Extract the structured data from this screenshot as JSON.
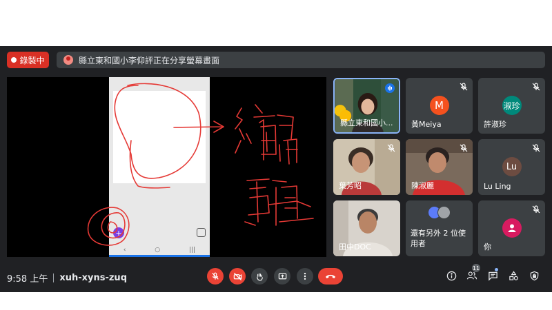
{
  "recording": {
    "label": "錄製中"
  },
  "share_banner": {
    "text": "縣立東和國小李仰評正在分享螢幕畫面"
  },
  "participants": [
    {
      "name": "縣立東和國小..."
    },
    {
      "name": "黃Meiya",
      "initial": "M"
    },
    {
      "name": "許淑珍",
      "initial": "淑珍"
    },
    {
      "name": "葉芳昭"
    },
    {
      "name": "陳淑麗"
    },
    {
      "name": "Lu Ling",
      "initial": "Lu"
    },
    {
      "name": "田中DOC"
    },
    {
      "name": "還有另外 2 位使用者"
    },
    {
      "name": "你"
    }
  ],
  "meeting": {
    "time": "9:58 上午",
    "code": "xuh-xyns-zuq"
  },
  "people_count": "11",
  "colors": {
    "record_red": "#d93025",
    "control_red": "#ea4335",
    "tile_bg": "#3c4043",
    "bar_bg": "#202124",
    "highlight": "#8ab4f8"
  }
}
